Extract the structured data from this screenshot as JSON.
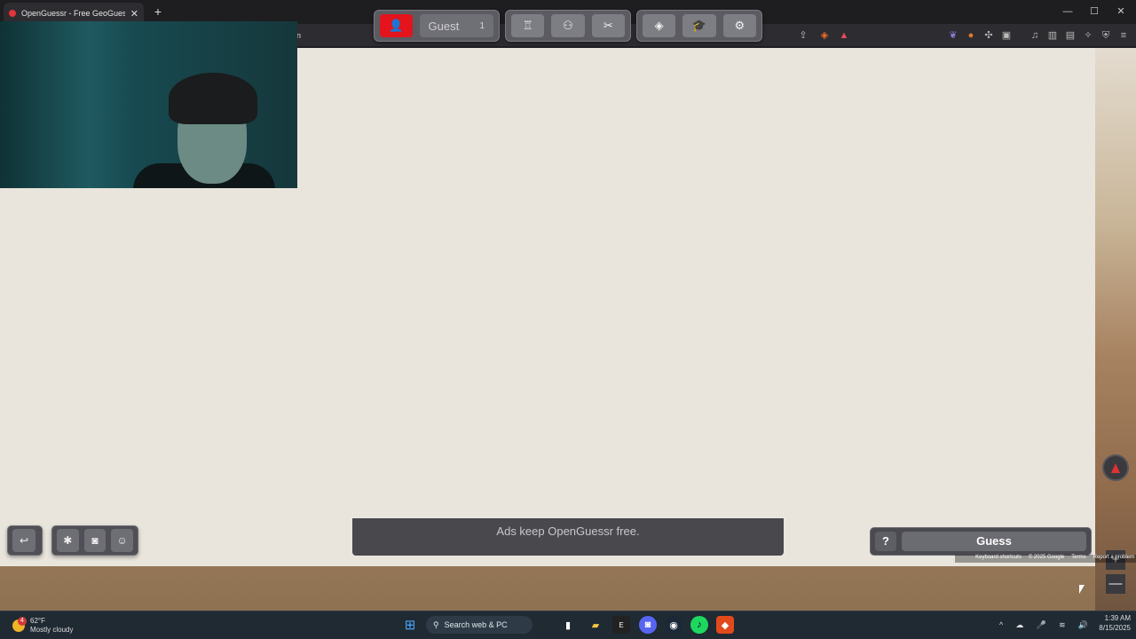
{
  "browser": {
    "tab_title": "OpenGuessr - Free GeoGuessr A",
    "tab_close": "✕",
    "new_tab": "+",
    "window_controls": [
      "—",
      "☐",
      "✕"
    ],
    "address_suffix": "n"
  },
  "topbar": {
    "guest_label": "Guest",
    "guest_count": "1",
    "icons": [
      "user-icon",
      "podium-icon",
      "multiplayer-icon",
      "tools-icon",
      "layers-icon",
      "graduation-icon",
      "gear-icon"
    ]
  },
  "bottom": {
    "ad_text": "Ads keep OpenGuessr free.",
    "help_label": "?",
    "guess_label": "Guess",
    "left_icons": [
      "back-icon",
      "bug-icon",
      "discord-icon",
      "reddit-icon"
    ]
  },
  "map_controls": {
    "zoom_in": "+",
    "zoom_out": "—",
    "attribution": [
      "Keyboard shortcuts",
      "© 2025 Google",
      "Terms",
      "Report a problem"
    ]
  },
  "taskbar": {
    "weather_temp": "62°F",
    "weather_desc": "Mostly cloudy",
    "weather_badge": "4",
    "search_placeholder": "Search web & PC",
    "time": "1:39 AM",
    "date": "8/15/2025"
  },
  "colors": {
    "accent_red": "#e4141c",
    "map_bg": "#e9e5dd",
    "panel": "#5b5b61"
  }
}
